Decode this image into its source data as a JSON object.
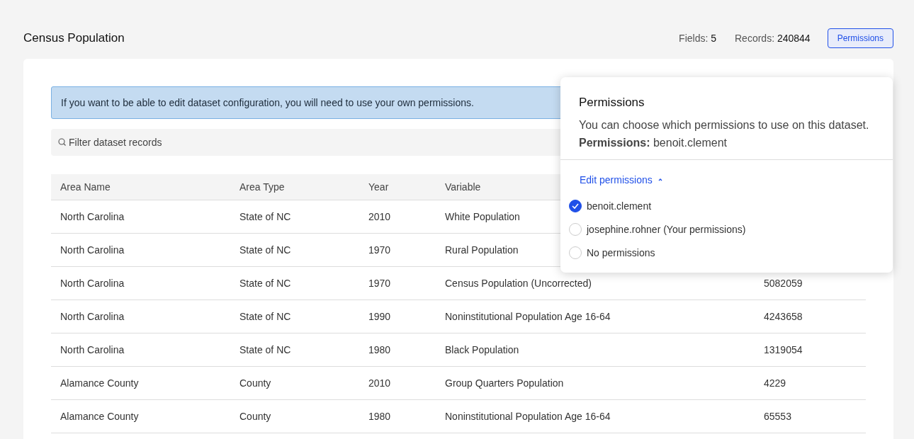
{
  "header": {
    "title": "Census Population",
    "fields_label": "Fields:",
    "fields": "5",
    "records_label": "Records:",
    "records": "240844",
    "permissions_button": "Permissions"
  },
  "banner": "If you want to be able to edit dataset configuration, you will need to use your own permissions.",
  "filter": {
    "placeholder": "Filter dataset records"
  },
  "table": {
    "columns": [
      "Area Name",
      "Area Type",
      "Year",
      "Variable"
    ],
    "rows": [
      [
        "North Carolina",
        "State of NC",
        "2010",
        "White Population"
      ],
      [
        "North Carolina",
        "State of NC",
        "1970",
        "Rural Population"
      ],
      [
        "North Carolina",
        "State of NC",
        "1970",
        "Census Population (Uncorrected)",
        "5082059"
      ],
      [
        "North Carolina",
        "State of NC",
        "1990",
        "Noninstitutional Population Age 16-64",
        "4243658"
      ],
      [
        "North Carolina",
        "State of NC",
        "1980",
        "Black Population",
        "1319054"
      ],
      [
        "Alamance County",
        "County",
        "2010",
        "Group Quarters Population",
        "4229"
      ],
      [
        "Alamance County",
        "County",
        "1980",
        "Noninstitutional Population Age 16-64",
        "65553"
      ]
    ]
  },
  "popover": {
    "title": "Permissions",
    "description": "You can choose which permissions to use on this dataset.",
    "current": "**Permissions:** benoit.clement",
    "edit_link": "Edit permissions",
    "expanded": true,
    "options": [
      {
        "label": "benoit.clement",
        "selected": true
      },
      {
        "label": "josephine.rohner (Your permissions)",
        "selected": false
      },
      {
        "label": "No permissions",
        "selected": false
      }
    ]
  }
}
